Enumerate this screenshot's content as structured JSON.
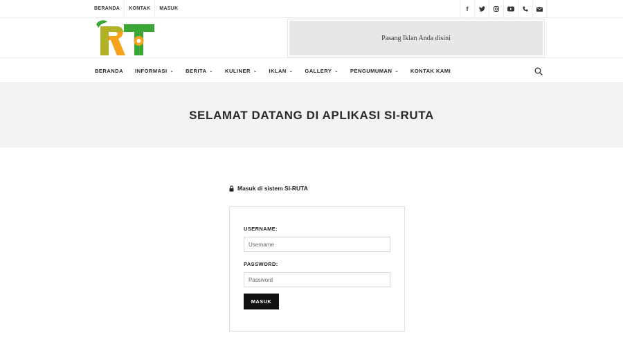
{
  "topbar": {
    "links": [
      "BERANDA",
      "KONTAK",
      "MASUK"
    ],
    "social": [
      {
        "icon": "facebook-icon",
        "glyph": "f"
      },
      {
        "icon": "twitter-icon",
        "glyph": "t"
      },
      {
        "icon": "instagram-icon",
        "glyph": "◎"
      },
      {
        "icon": "youtube-icon",
        "glyph": "▶"
      },
      {
        "icon": "phone-icon",
        "glyph": "✆"
      },
      {
        "icon": "mail-icon",
        "glyph": "✉"
      }
    ]
  },
  "header": {
    "logo_text": "RT",
    "ad_text": "Pasang Iklan Anda disini"
  },
  "nav": {
    "items": [
      {
        "label": "BERANDA",
        "dropdown": false
      },
      {
        "label": "INFORMASI",
        "dropdown": true
      },
      {
        "label": "BERITA",
        "dropdown": true
      },
      {
        "label": "KULINER",
        "dropdown": true
      },
      {
        "label": "IKLAN",
        "dropdown": true
      },
      {
        "label": "GALLERY",
        "dropdown": true
      },
      {
        "label": "PENGUMUMAN",
        "dropdown": true
      },
      {
        "label": "KONTAK KAMI",
        "dropdown": false
      }
    ]
  },
  "hero": {
    "title": "SELAMAT DATANG DI APLIKASI SI-RUTA"
  },
  "login": {
    "heading": "Masuk di sistem SI-RUTA",
    "username_label": "USERNAME:",
    "username_placeholder": "Username",
    "username_value": "",
    "password_label": "PASSWORD:",
    "password_placeholder": "Password",
    "password_value": "",
    "submit_label": "MASUK"
  },
  "colors": {
    "logo_green": "#3aa635",
    "logo_orange": "#f6a21a",
    "button_bg": "#111111",
    "hero_bg": "#f2f2f2"
  }
}
